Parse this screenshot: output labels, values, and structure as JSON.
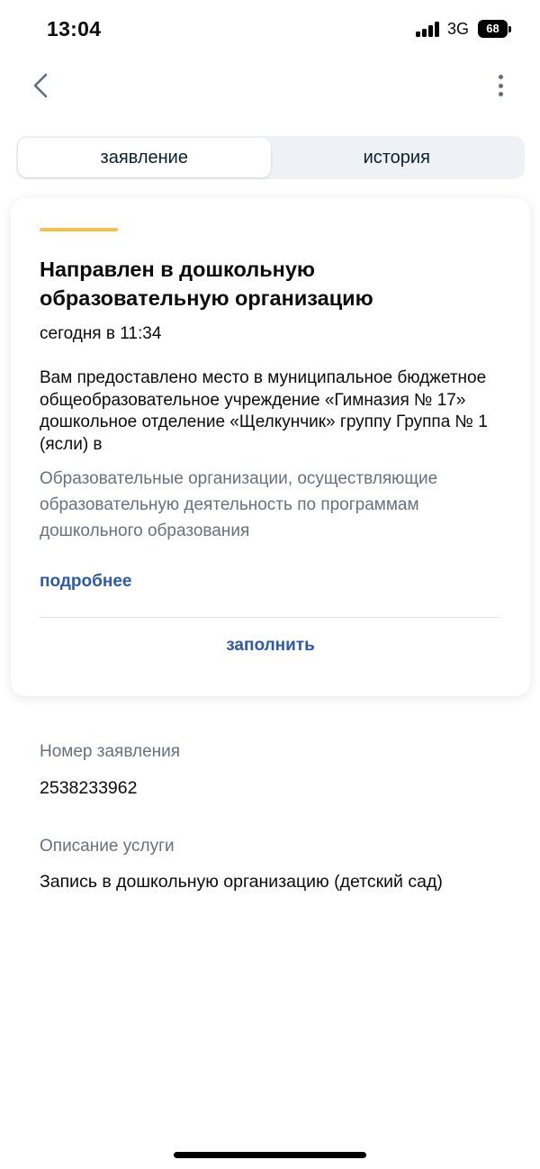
{
  "status_bar": {
    "time": "13:04",
    "network": "3G",
    "battery": "68"
  },
  "nav": {
    "back_icon": "chevron-left-icon",
    "more_icon": "more-vertical-icon"
  },
  "tabs": [
    {
      "label": "заявление",
      "active": true
    },
    {
      "label": "история",
      "active": false
    }
  ],
  "card": {
    "accent_color": "#f2c14e",
    "title": "Направлен в дошкольную образовательную организацию",
    "time": "сегодня в 11:34",
    "message": "Вам предоставлено место в муниципальное бюджетное общеобразовательное учреждение «Гимназия № 17» дошкольное отделение «Щелкунчик» группу Группа № 1 (ясли) в",
    "organization_type": "Образовательные организации, осуществляющие образовательную деятельность по программам дошкольного образования",
    "more_link": "подробнее",
    "fill_button": "заполнить"
  },
  "details": {
    "application_number_label": "Номер заявления",
    "application_number": "2538233962",
    "service_description_label": "Описание услуги",
    "service_description": "Запись в дошкольную организацию (детский сад)"
  },
  "colors": {
    "link": "#2d5ba8",
    "muted_text": "#66727f",
    "tab_background": "#eef2f7"
  }
}
